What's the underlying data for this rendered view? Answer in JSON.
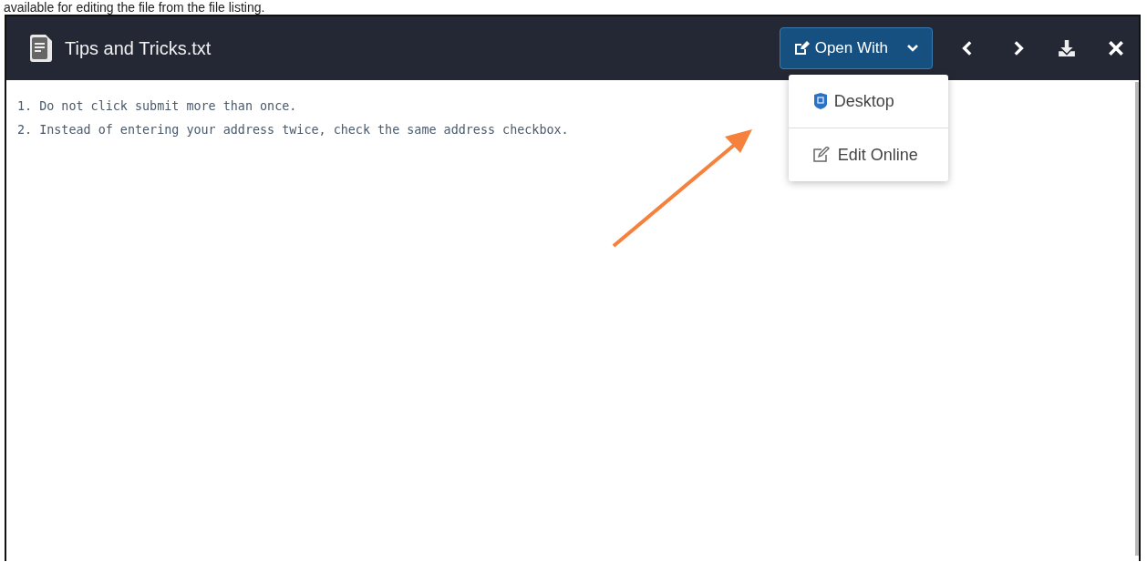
{
  "caption": "available for editing the file from the file listing.",
  "viewer": {
    "title": "Tips and Tricks.txt",
    "open_with": {
      "label": "Open With",
      "expanded": true,
      "menu": [
        {
          "label": "Desktop",
          "kind": "desktop"
        },
        {
          "label": "Edit Online",
          "kind": "edit"
        }
      ]
    },
    "lines": [
      "1. Do not click submit more than once.",
      "2. Instead of entering your address twice, check the same address checkbox."
    ]
  }
}
